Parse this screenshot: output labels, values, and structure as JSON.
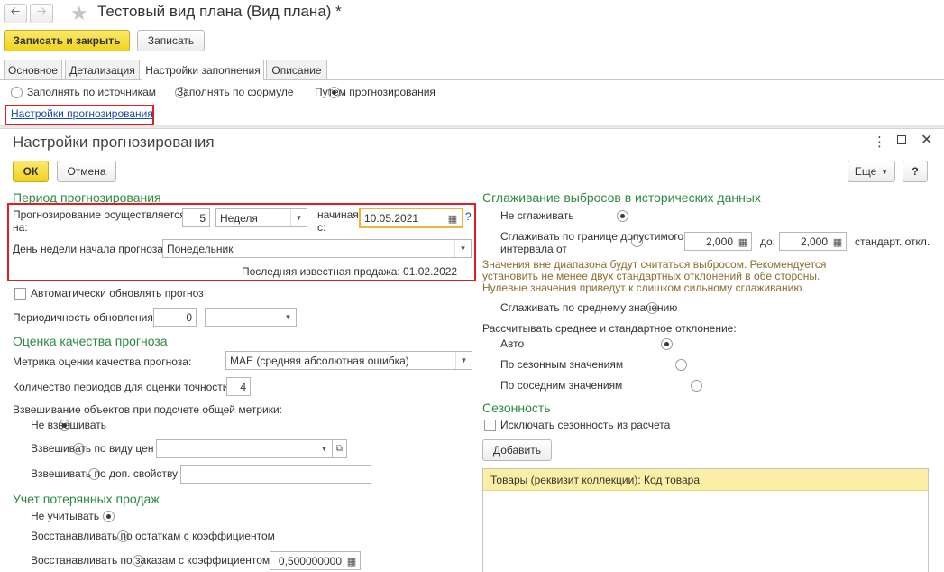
{
  "window": {
    "title": "Тестовый вид плана (Вид плана) *"
  },
  "toolbar": {
    "save_close": "Записать и закрыть",
    "save": "Записать"
  },
  "tabs": [
    {
      "label": "Основное"
    },
    {
      "label": "Детализация"
    },
    {
      "label": "Настройки заполнения"
    },
    {
      "label": "Описание"
    }
  ],
  "fill_options": {
    "by_sources": "Заполнять по источникам",
    "by_formula": "Заполнять по формуле",
    "forecasting": "Путем прогнозирования"
  },
  "link": "Настройки прогнозирования",
  "dialog": {
    "title": "Настройки прогнозирования",
    "ok": "ОК",
    "cancel": "Отмена",
    "more": "Еще",
    "help": "?",
    "period": {
      "header": "Период прогнозирования",
      "forecast_label_1": "Прогнозирование осуществляется",
      "forecast_label_2": "на:",
      "count": "5",
      "unit": "Неделя",
      "start_label_1": "начиная",
      "start_label_2": "с:",
      "start_date": "10.05.2021",
      "q": "?",
      "weekday_label": "День недели начала прогноза:",
      "weekday": "Понедельник",
      "last_sale": "Последняя известная продажа:  01.02.2022"
    },
    "auto_update": "Автоматически обновлять прогноз",
    "periodicity_label": "Периодичность обновления:",
    "periodicity_value": "0",
    "quality": {
      "header": "Оценка качества прогноза",
      "metric_label": "Метрика оценки качества прогноза:",
      "metric": "MAE (средняя абсолютная ошибка)",
      "periods_label": "Количество периодов для оценки точности:",
      "periods": "4",
      "weighting_label": "Взвешивание объектов при подсчете общей метрики:",
      "no_weight": "Не взвешивать",
      "by_price": "Взвешивать по виду цен",
      "by_property": "Взвешивать по доп. свойству"
    },
    "lost": {
      "header": "Учет потерянных продаж",
      "ignore": "Не учитывать",
      "by_stock": "Восстанавливать по остаткам с коэффициентом",
      "by_orders": "Восстанавливать по заказам с коэффициентом",
      "coef": "0,500000000"
    },
    "smoothing": {
      "header": "Сглаживание выбросов в исторических данных",
      "none": "Не сглаживать",
      "by_border_1": "Сглаживать по границе допустимого",
      "by_border_2": "интервала от",
      "from": "2,000",
      "to_label": "до:",
      "to": "2,000",
      "std": "стандарт. откл.",
      "note_1": "Значения вне диапазона будут считаться выбросом. Рекомендуется",
      "note_2": "установить не менее двух стандартных отклонений в обе стороны.",
      "note_3": "Нулевые значения приведут к слишком сильному сглаживанию.",
      "by_mean": "Сглаживать по среднему значению",
      "calc_label": "Рассчитывать среднее и стандартное отклонение:",
      "auto": "Авто",
      "seasonal": "По сезонным значениям",
      "neighbor": "По соседним значениям"
    },
    "season": {
      "header": "Сезонность",
      "exclude": "Исключать сезонность из расчета",
      "add": "Добавить",
      "table_header": "Товары (реквизит коллекции): Код товара"
    }
  },
  "colors": {
    "accent_green": "#2c8a3e",
    "highlight_red": "#e02020",
    "date_border": "#f0b33c",
    "yellow": "#f0d21f",
    "link": "#1f4fa3"
  }
}
